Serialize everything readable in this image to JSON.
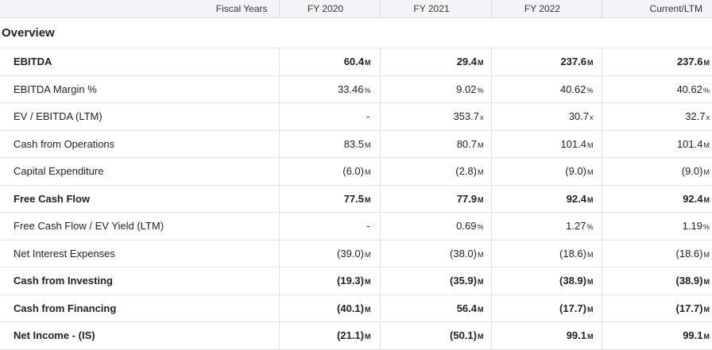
{
  "header": {
    "label": "Fiscal Years",
    "columns": [
      "FY 2020",
      "FY 2021",
      "FY 2022",
      "Current/LTM"
    ]
  },
  "section": {
    "title": "Overview"
  },
  "rows": [
    {
      "label": "EBITDA",
      "bold": true,
      "values": [
        [
          "60.4",
          "M"
        ],
        [
          "29.4",
          "M"
        ],
        [
          "237.6",
          "M"
        ],
        [
          "237.6",
          "M"
        ]
      ]
    },
    {
      "label": "EBITDA Margin %",
      "bold": false,
      "values": [
        [
          "33.46",
          "%"
        ],
        [
          "9.02",
          "%"
        ],
        [
          "40.62",
          "%"
        ],
        [
          "40.62",
          "%"
        ]
      ]
    },
    {
      "label": "EV / EBITDA (LTM)",
      "bold": false,
      "values": [
        [
          "-",
          ""
        ],
        [
          "353.7",
          "x"
        ],
        [
          "30.7",
          "x"
        ],
        [
          "32.7",
          "x"
        ]
      ]
    },
    {
      "label": "Cash from Operations",
      "bold": false,
      "values": [
        [
          "83.5",
          "M"
        ],
        [
          "80.7",
          "M"
        ],
        [
          "101.4",
          "M"
        ],
        [
          "101.4",
          "M"
        ]
      ]
    },
    {
      "label": "Capital Expenditure",
      "bold": false,
      "values": [
        [
          "(6.0)",
          "M"
        ],
        [
          "(2.8)",
          "M"
        ],
        [
          "(9.0)",
          "M"
        ],
        [
          "(9.0)",
          "M"
        ]
      ]
    },
    {
      "label": "Free Cash Flow",
      "bold": true,
      "values": [
        [
          "77.5",
          "M"
        ],
        [
          "77.9",
          "M"
        ],
        [
          "92.4",
          "M"
        ],
        [
          "92.4",
          "M"
        ]
      ]
    },
    {
      "label": "Free Cash Flow / EV Yield (LTM)",
      "bold": false,
      "values": [
        [
          "-",
          ""
        ],
        [
          "0.69",
          "%"
        ],
        [
          "1.27",
          "%"
        ],
        [
          "1.19",
          "%"
        ]
      ]
    },
    {
      "label": "Net Interest Expenses",
      "bold": false,
      "values": [
        [
          "(39.0)",
          "M"
        ],
        [
          "(38.0)",
          "M"
        ],
        [
          "(18.6)",
          "M"
        ],
        [
          "(18.6)",
          "M"
        ]
      ]
    },
    {
      "label": "Cash from Investing",
      "bold": true,
      "values": [
        [
          "(19.3)",
          "M"
        ],
        [
          "(35.9)",
          "M"
        ],
        [
          "(38.9)",
          "M"
        ],
        [
          "(38.9)",
          "M"
        ]
      ]
    },
    {
      "label": "Cash from Financing",
      "bold": true,
      "values": [
        [
          "(40.1)",
          "M"
        ],
        [
          "56.4",
          "M"
        ],
        [
          "(17.7)",
          "M"
        ],
        [
          "(17.7)",
          "M"
        ]
      ]
    },
    {
      "label": "Net Income - (IS)",
      "bold": true,
      "values": [
        [
          "(21.1)",
          "M"
        ],
        [
          "(50.1)",
          "M"
        ],
        [
          "99.1",
          "M"
        ],
        [
          "99.1",
          "M"
        ]
      ]
    }
  ]
}
